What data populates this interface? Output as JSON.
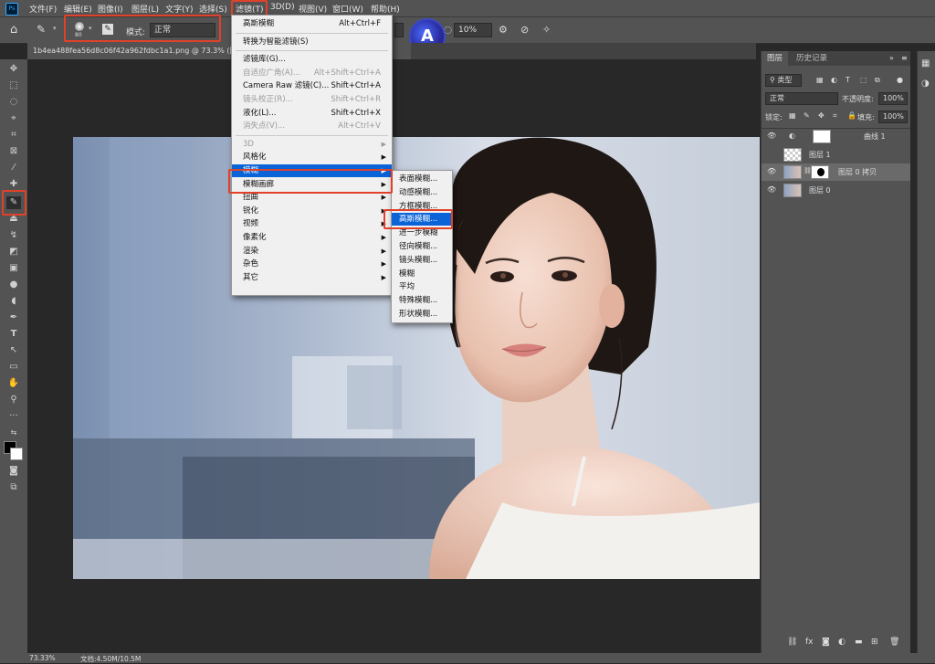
{
  "menubar": {
    "items": [
      "文件(F)",
      "编辑(E)",
      "图像(I)",
      "图层(L)",
      "文字(Y)",
      "选择(S)",
      "滤镜(T)",
      "3D(D)",
      "视图(V)",
      "窗口(W)",
      "帮助(H)"
    ],
    "ps_logo": "Ps"
  },
  "optionsbar": {
    "brush_size": "80",
    "mode_label": "模式:",
    "mode_value": "正常",
    "flow_value": "10%"
  },
  "document": {
    "tab_title": "1b4ea488fea56d8c06f42a962fdbc1a1.png @ 73.3% (图层"
  },
  "filter_menu": {
    "items": [
      {
        "label": "高斯模糊",
        "shortcut": "Alt+Ctrl+F",
        "disabled": false
      },
      {
        "label": "转换为智能滤镜(S)",
        "shortcut": "",
        "disabled": false
      },
      {
        "label": "滤镜库(G)...",
        "shortcut": "",
        "disabled": false
      },
      {
        "label": "自适应广角(A)...",
        "shortcut": "Alt+Shift+Ctrl+A",
        "disabled": true
      },
      {
        "label": "Camera Raw 滤镜(C)...",
        "shortcut": "Shift+Ctrl+A",
        "disabled": false
      },
      {
        "label": "镜头校正(R)...",
        "shortcut": "Shift+Ctrl+R",
        "disabled": true
      },
      {
        "label": "液化(L)...",
        "shortcut": "Shift+Ctrl+X",
        "disabled": false
      },
      {
        "label": "消失点(V)...",
        "shortcut": "Alt+Ctrl+V",
        "disabled": true
      },
      {
        "label": "3D",
        "shortcut": "",
        "disabled": true,
        "submenu": true
      },
      {
        "label": "风格化",
        "shortcut": "",
        "disabled": false,
        "submenu": true
      },
      {
        "label": "模糊",
        "shortcut": "",
        "disabled": false,
        "submenu": true,
        "highlight": true
      },
      {
        "label": "模糊画廊",
        "shortcut": "",
        "disabled": false,
        "submenu": true
      },
      {
        "label": "扭曲",
        "shortcut": "",
        "disabled": false,
        "submenu": true
      },
      {
        "label": "锐化",
        "shortcut": "",
        "disabled": false,
        "submenu": true
      },
      {
        "label": "视频",
        "shortcut": "",
        "disabled": false,
        "submenu": true
      },
      {
        "label": "像素化",
        "shortcut": "",
        "disabled": false,
        "submenu": true
      },
      {
        "label": "渲染",
        "shortcut": "",
        "disabled": false,
        "submenu": true
      },
      {
        "label": "杂色",
        "shortcut": "",
        "disabled": false,
        "submenu": true
      },
      {
        "label": "其它",
        "shortcut": "",
        "disabled": false,
        "submenu": true
      }
    ]
  },
  "blur_submenu": {
    "items": [
      "表面模糊...",
      "动感模糊...",
      "方框模糊...",
      "高斯模糊...",
      "进一步模糊",
      "径向模糊...",
      "镜头模糊...",
      "模糊",
      "平均",
      "特殊模糊...",
      "形状模糊..."
    ],
    "highlighted_index": 3
  },
  "layers_panel": {
    "tabs": [
      "图层",
      "历史记录"
    ],
    "filter_kind": "类型",
    "blend_mode": "正常",
    "opacity_label": "不透明度:",
    "opacity_value": "100%",
    "lock_label": "锁定:",
    "fill_label": "填充:",
    "fill_value": "100%",
    "layers": [
      {
        "name": "曲线 1",
        "visible": true,
        "selected": false
      },
      {
        "name": "图层 1",
        "visible": false,
        "selected": false
      },
      {
        "name": "图层 0 拷贝",
        "visible": true,
        "selected": true
      },
      {
        "name": "图层 0",
        "visible": true,
        "selected": false
      }
    ]
  },
  "statusbar": {
    "zoom": "73.33%",
    "doc_info": "文档:4.50M/10.5M"
  },
  "colors": {
    "highlight_red": "#e0412a",
    "menu_highlight": "#0a64d8",
    "ui_gray": "#535353"
  }
}
